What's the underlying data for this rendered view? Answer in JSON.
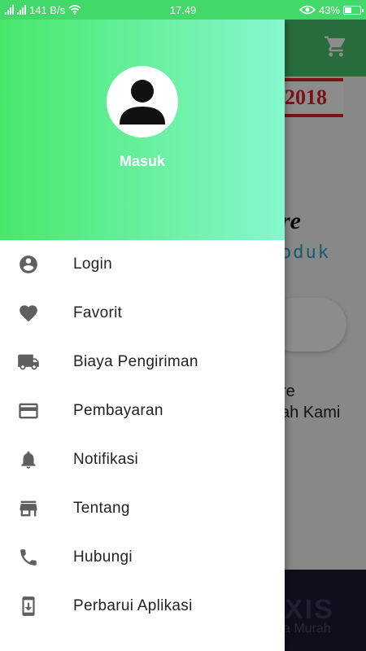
{
  "status_bar": {
    "network_speed": "141 B/s",
    "time": "17.49",
    "battery": "43%",
    "battery_level": 0.43
  },
  "background_app": {
    "banner_text": "2018",
    "headline_fragment": "re",
    "subline_fragment": "oduk",
    "text_line1": "re",
    "text_line2": "ah Kami",
    "bottom_logo": "XIS",
    "bottom_text": "sa Murah"
  },
  "drawer": {
    "header_title": "Masuk",
    "colors": {
      "gradient_start": "#47e86a",
      "gradient_end": "#86f7cf",
      "icon": "#5f5f5f"
    },
    "items": [
      {
        "label": "Login",
        "icon": "account-circle-icon"
      },
      {
        "label": "Favorit",
        "icon": "heart-icon"
      },
      {
        "label": "Biaya Pengiriman",
        "icon": "truck-icon"
      },
      {
        "label": "Pembayaran",
        "icon": "credit-card-icon"
      },
      {
        "label": "Notifikasi",
        "icon": "bell-icon"
      },
      {
        "label": "Tentang",
        "icon": "store-icon"
      },
      {
        "label": "Hubungi",
        "icon": "phone-icon"
      },
      {
        "label": "Perbarui Aplikasi",
        "icon": "system-update-icon"
      }
    ]
  }
}
